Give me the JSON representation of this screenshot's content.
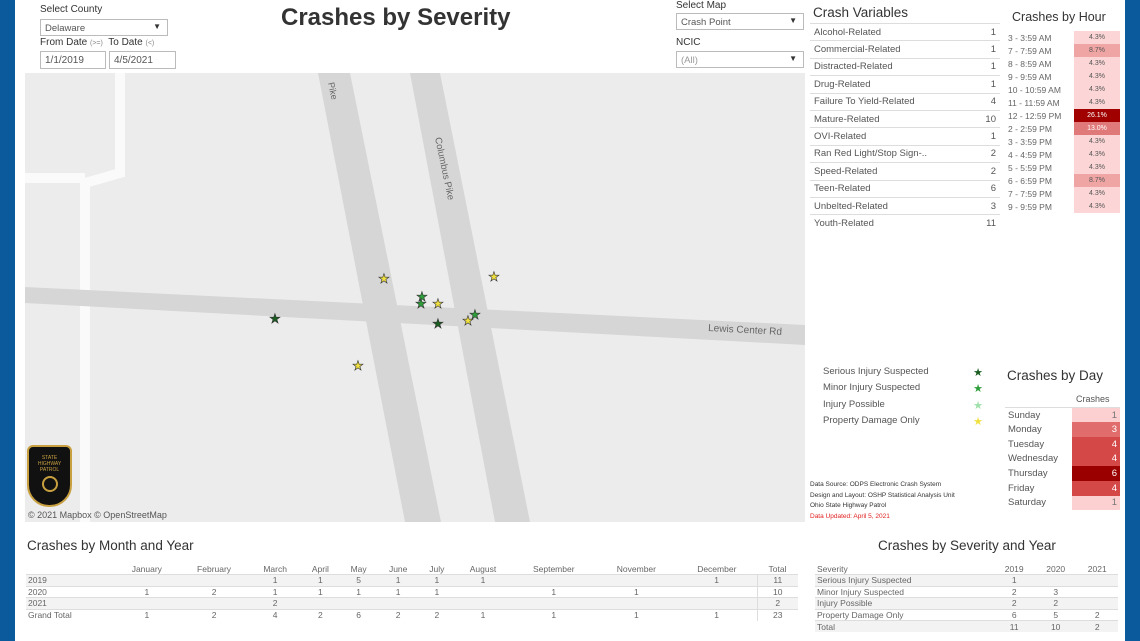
{
  "header": {
    "title": "Crashes by Severity",
    "county_label": "Select County",
    "county_value": "Delaware",
    "from_label": "From Date",
    "from_hint": "(>=)",
    "to_label": "To Date",
    "to_hint": "(<)",
    "from_value": "1/1/2019",
    "to_value": "4/5/2021",
    "map_label": "Select Map",
    "map_value": "Crash Point",
    "ncic_label": "NCIC",
    "ncic_value": "(All)"
  },
  "map": {
    "roads": [
      "Lewis Center Rd",
      "Columbus Pike",
      "Pike"
    ],
    "attribution": "© 2021 Mapbox © OpenStreetMap",
    "logo_text": "STATE HIGHWAY PATROL OHIO",
    "points": [
      {
        "severity": "Property Damage Only"
      },
      {
        "severity": "Property Damage Only"
      },
      {
        "severity": "Minor Injury Suspected"
      },
      {
        "severity": "Minor Injury Suspected"
      },
      {
        "severity": "Property Damage Only"
      },
      {
        "severity": "Serious Injury Suspected"
      },
      {
        "severity": "Serious Injury Suspected"
      },
      {
        "severity": "Property Damage Only"
      },
      {
        "severity": "Minor Injury Suspected"
      },
      {
        "severity": "Property Damage Only"
      }
    ]
  },
  "crash_variables": {
    "title": "Crash Variables",
    "rows": [
      [
        "Alcohol-Related",
        "1"
      ],
      [
        "Commercial-Related",
        "1"
      ],
      [
        "Distracted-Related",
        "1"
      ],
      [
        "Drug-Related",
        "1"
      ],
      [
        "Failure To Yield-Related",
        "4"
      ],
      [
        "Mature-Related",
        "10"
      ],
      [
        "OVI-Related",
        "1"
      ],
      [
        "Ran Red Light/Stop Sign-..",
        "2"
      ],
      [
        "Speed-Related",
        "2"
      ],
      [
        "Teen-Related",
        "6"
      ],
      [
        "Unbelted-Related",
        "3"
      ],
      [
        "Youth-Related",
        "11"
      ]
    ]
  },
  "crashes_by_hour": {
    "title": "Crashes by Hour",
    "rows": [
      [
        "3 - 3:59 AM",
        "4.3%"
      ],
      [
        "7 - 7:59 AM",
        "8.7%"
      ],
      [
        "8 - 8:59 AM",
        "4.3%"
      ],
      [
        "9 - 9:59 AM",
        "4.3%"
      ],
      [
        "10 - 10:59 AM",
        "4.3%"
      ],
      [
        "11 - 11:59 AM",
        "4.3%"
      ],
      [
        "12 - 12:59 PM",
        "26.1%"
      ],
      [
        "2 - 2:59 PM",
        "13.0%"
      ],
      [
        "3 - 3:59 PM",
        "4.3%"
      ],
      [
        "4 - 4:59 PM",
        "4.3%"
      ],
      [
        "5 - 5:59 PM",
        "4.3%"
      ],
      [
        "6 - 6:59 PM",
        "8.7%"
      ],
      [
        "7 - 7:59 PM",
        "4.3%"
      ],
      [
        "9 - 9:59 PM",
        "4.3%"
      ]
    ]
  },
  "legend": {
    "items": [
      {
        "label": "Serious Injury Suspected",
        "color": "#1a5e20"
      },
      {
        "label": "Minor Injury Suspected",
        "color": "#2e9e3a"
      },
      {
        "label": "Injury Possible",
        "color": "#9fe0a8"
      },
      {
        "label": "Property Damage Only",
        "color": "#f0e040"
      }
    ]
  },
  "source": {
    "line1": "Data Source: ODPS Electronic Crash System",
    "line2": "Design and Layout: OSHP Statistical Analysis Unit",
    "line3": "Ohio State Highway Patrol",
    "updated": "Data Updated: April 5, 2021"
  },
  "crashes_by_day": {
    "title": "Crashes by Day",
    "column": "Crashes",
    "rows": [
      [
        "Sunday",
        "1"
      ],
      [
        "Monday",
        "3"
      ],
      [
        "Tuesday",
        "4"
      ],
      [
        "Wednesday",
        "4"
      ],
      [
        "Thursday",
        "6"
      ],
      [
        "Friday",
        "4"
      ],
      [
        "Saturday",
        "1"
      ]
    ]
  },
  "month_year": {
    "title": "Crashes by Month and Year",
    "columns": [
      "",
      "January",
      "February",
      "March",
      "April",
      "May",
      "June",
      "July",
      "August",
      "September",
      "November",
      "December",
      "Total"
    ],
    "rows": [
      [
        "2019",
        "",
        "",
        "1",
        "1",
        "5",
        "1",
        "1",
        "1",
        "",
        "",
        "1",
        "11"
      ],
      [
        "2020",
        "1",
        "2",
        "1",
        "1",
        "1",
        "1",
        "1",
        "",
        "1",
        "1",
        "",
        "10"
      ],
      [
        "2021",
        "",
        "",
        "2",
        "",
        "",
        "",
        "",
        "",
        "",
        "",
        "",
        "2"
      ],
      [
        "Grand Total",
        "1",
        "2",
        "4",
        "2",
        "6",
        "2",
        "2",
        "1",
        "1",
        "1",
        "1",
        "23"
      ]
    ]
  },
  "severity_year": {
    "title": "Crashes by Severity and Year",
    "columns": [
      "Severity",
      "2019",
      "2020",
      "2021"
    ],
    "rows": [
      [
        "Serious Injury Suspected",
        "1",
        "",
        ""
      ],
      [
        "Minor Injury Suspected",
        "2",
        "3",
        ""
      ],
      [
        "Injury Possible",
        "2",
        "2",
        ""
      ],
      [
        "Property Damage Only",
        "6",
        "5",
        "2"
      ],
      [
        "Total",
        "11",
        "10",
        "2"
      ]
    ]
  }
}
